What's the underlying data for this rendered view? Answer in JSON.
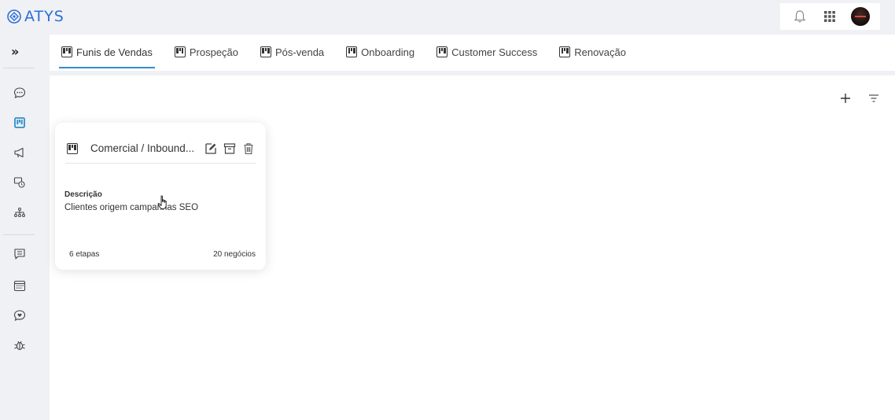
{
  "app": {
    "logo_text": "ATYS",
    "accent_color": "#2b6fd6",
    "tab_underline_color": "#2f8fc9"
  },
  "header": {
    "icons": [
      "bell-icon",
      "apps-grid-icon",
      "user-avatar"
    ]
  },
  "sidebar": {
    "toggle_label": "»",
    "items": [
      {
        "name": "chat-icon"
      },
      {
        "name": "kanban-icon",
        "active": true
      },
      {
        "name": "megaphone-icon"
      },
      {
        "name": "support-icon"
      },
      {
        "name": "org-chart-icon"
      },
      {
        "name": "message-icon"
      },
      {
        "name": "calendar-icon"
      },
      {
        "name": "heart-chat-icon"
      },
      {
        "name": "bug-icon"
      }
    ]
  },
  "tabs": [
    {
      "label": "Funis de Vendas",
      "active": true
    },
    {
      "label": "Prospeção"
    },
    {
      "label": "Pós-venda"
    },
    {
      "label": "Onboarding"
    },
    {
      "label": "Customer Success"
    },
    {
      "label": "Renovação"
    }
  ],
  "toolbar": {
    "add_icon": "plus-icon",
    "filter_icon": "filter-icon"
  },
  "card": {
    "title": "Comercial / Inbound...",
    "description_label": "Descrição",
    "description": "Clientes origem campanhas SEO",
    "stages": "6 etapas",
    "deals": "20 negócios"
  }
}
